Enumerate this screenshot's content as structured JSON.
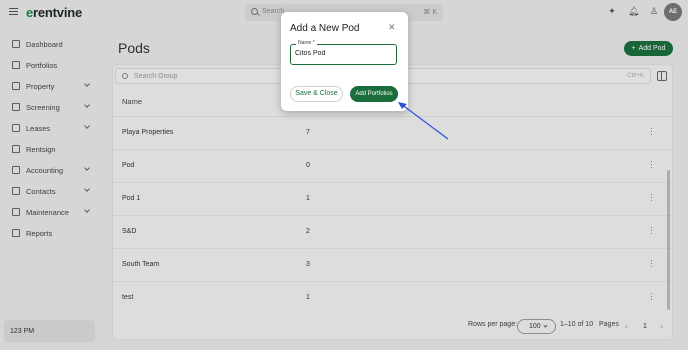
{
  "app": {
    "logo_prefix": "e",
    "logo_rest": "rentvine"
  },
  "topbar": {
    "search_placeholder": "Search",
    "search_shortcut": "⌘ K",
    "icons": [
      "sparkle-icon",
      "bell-icon",
      "user-icon"
    ],
    "avatar_initials": "AE"
  },
  "sidebar": {
    "items": [
      {
        "label": "Dashboard",
        "icon": "dashboard-icon",
        "expandable": false
      },
      {
        "label": "Portfolios",
        "icon": "portfolio-icon",
        "expandable": false
      },
      {
        "label": "Property",
        "icon": "property-icon",
        "expandable": true
      },
      {
        "label": "Screening",
        "icon": "screening-icon",
        "expandable": true
      },
      {
        "label": "Leases",
        "icon": "lease-icon",
        "expandable": true
      },
      {
        "label": "Rentsign",
        "icon": "rentsign-icon",
        "expandable": false
      },
      {
        "label": "Accounting",
        "icon": "accounting-icon",
        "expandable": true
      },
      {
        "label": "Contacts",
        "icon": "contacts-icon",
        "expandable": true
      },
      {
        "label": "Maintenance",
        "icon": "maintenance-icon",
        "expandable": true
      },
      {
        "label": "Reports",
        "icon": "reports-icon",
        "expandable": false
      }
    ],
    "time_label": "123 PM"
  },
  "main": {
    "title": "Pods",
    "add_button_label": "Add Pod",
    "search_placeholder": "Search Group",
    "search_shortcut": "Ctrl+K",
    "column_header_name": "Name",
    "rows": [
      {
        "name": "Playa Properties",
        "count": "7"
      },
      {
        "name": "Pod",
        "count": "0"
      },
      {
        "name": "Pod 1",
        "count": "1"
      },
      {
        "name": "S&D",
        "count": "2"
      },
      {
        "name": "South Team",
        "count": "3"
      },
      {
        "name": "test",
        "count": "1"
      }
    ],
    "pagination": {
      "rows_per_page_label": "Rows per page:",
      "rows_per_page_value": "100",
      "range_text": "1–10 of 10",
      "pages_label": "Pages",
      "current_page": "1"
    }
  },
  "modal": {
    "title": "Add a New Pod",
    "field_label": "Name *",
    "field_value": "Citos Pod",
    "save_close_label": "Save & Close",
    "add_portfolios_label": "Add Portfolios"
  },
  "colors": {
    "brand_green": "#1b6e3c",
    "annotation_arrow": "#2b4fd8"
  }
}
